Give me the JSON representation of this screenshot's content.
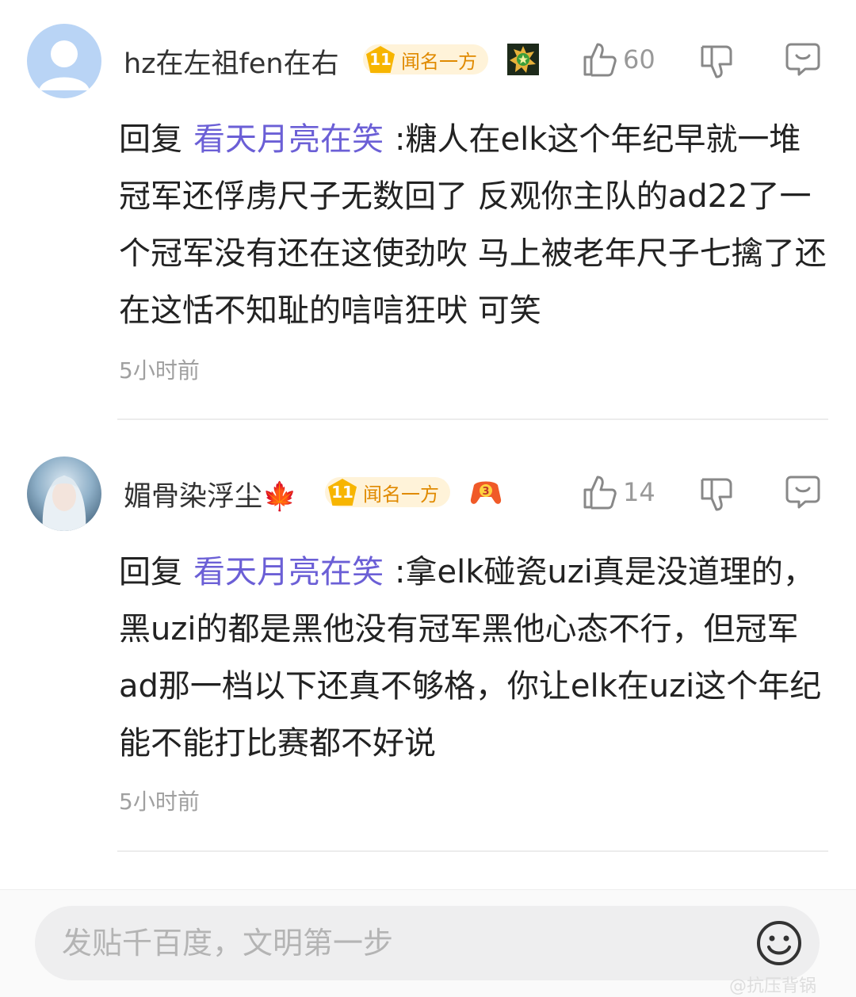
{
  "comments": [
    {
      "username": "hz在左祖fen在右",
      "level": "11",
      "level_title": "闻名一方",
      "likes": "60",
      "reply_prefix": "回复",
      "reply_target": "看天月亮在笑",
      "text": ":糖人在elk这个年纪早就一堆冠军还俘虏尺子无数回了 反观你主队的ad22了一个冠军没有还在这使劲吹 马上被老年尺子七擒了还在这恬不知耻的唁唁狂吠 可笑",
      "time": "5小时前"
    },
    {
      "username": "媚骨染浮尘🍁",
      "level": "11",
      "level_title": "闻名一方",
      "likes": "14",
      "reply_prefix": "回复",
      "reply_target": "看天月亮在笑",
      "text": ":拿elk碰瓷uzi真是没道理的，黑uzi的都是黑他没有冠军黑他心态不行，但冠军ad那一档以下还真不够格，你让elk在uzi这个年纪能不能打比赛都不好说",
      "time": "5小时前"
    }
  ],
  "input": {
    "placeholder": "发贴千百度，文明第一步"
  },
  "watermark": "@抗压背锅",
  "colors": {
    "accent": "#6b5fd6",
    "badge": "#f7b500"
  }
}
